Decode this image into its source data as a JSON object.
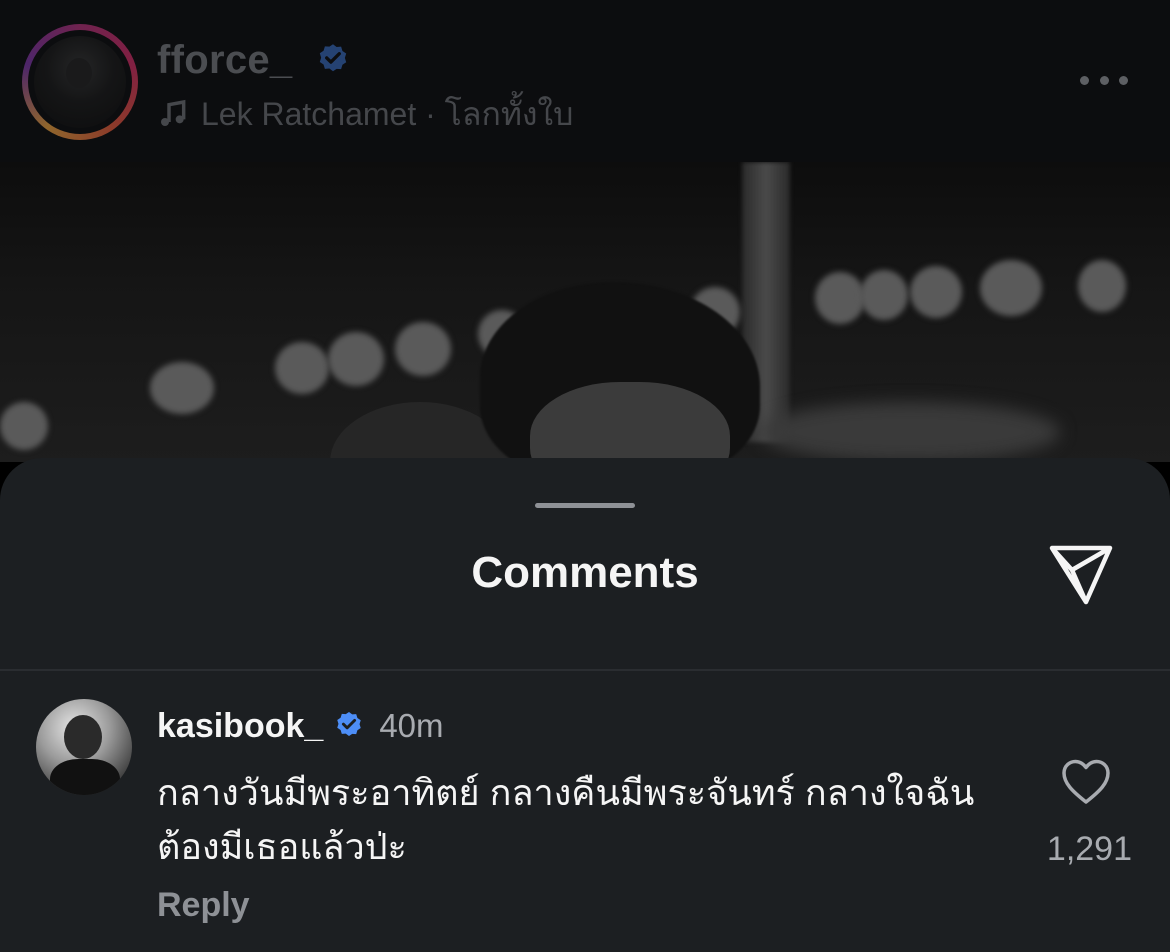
{
  "post": {
    "username": "fforce_",
    "verified": true,
    "music": "Lek Ratchamet · โลกทั้งใบ",
    "avatar_icon": "profile-photo",
    "more_icon": "more-horizontal-icon"
  },
  "sheet": {
    "title": "Comments",
    "share_icon": "paper-plane-icon"
  },
  "comment": {
    "username": "kasibook_",
    "verified": true,
    "time": "40m",
    "text": "กลางวันมีพระอาทิตย์ กลางคืนมีพระจันทร์ กลางใจฉันต้องมีเธอแล้วป่ะ",
    "like_count": "1,291",
    "reply_label": "Reply",
    "like_icon": "heart-outline-icon"
  },
  "colors": {
    "background": "#1c1f22",
    "text_primary": "#f5f5f5",
    "text_secondary": "#a8abb0",
    "verified_blue": "#4d8ef7"
  }
}
